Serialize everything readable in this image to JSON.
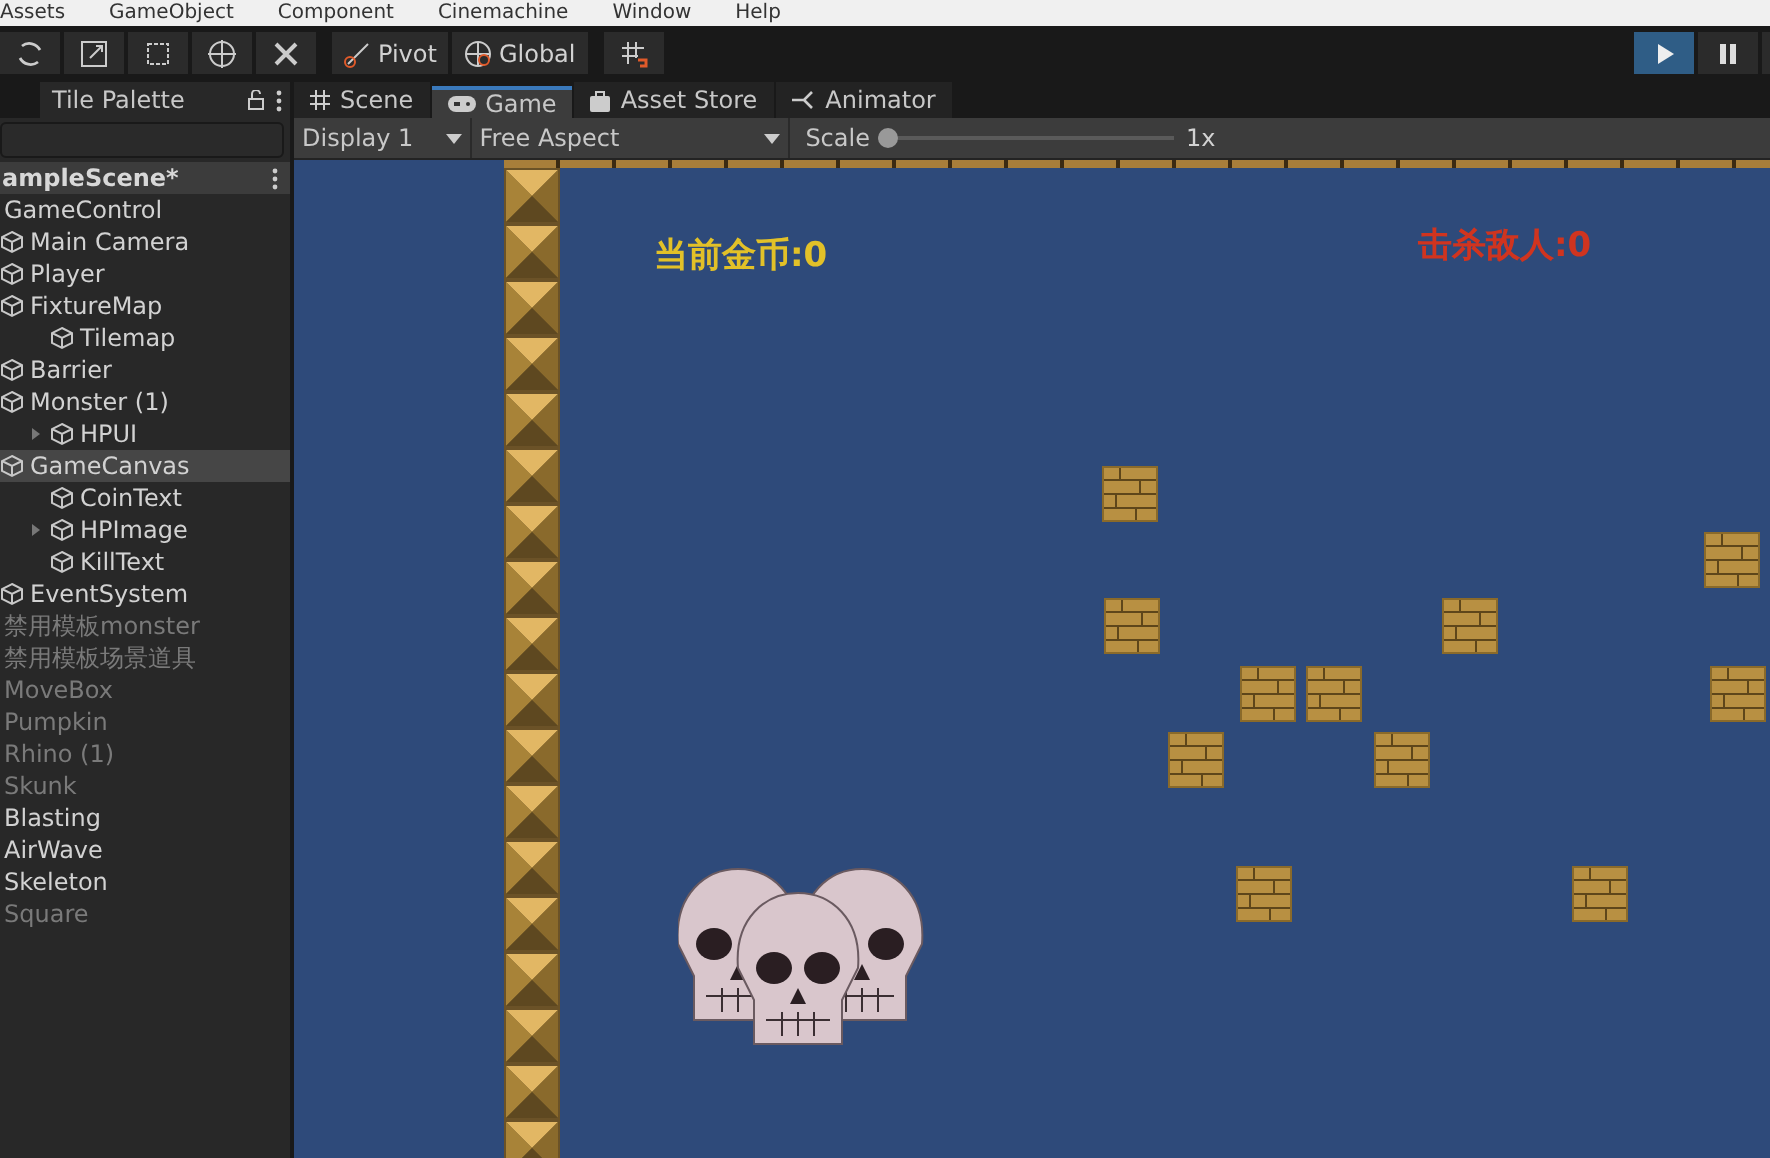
{
  "menu": [
    "Assets",
    "GameObject",
    "Component",
    "Cinemachine",
    "Window",
    "Help"
  ],
  "toolbar": {
    "pivot": "Pivot",
    "global": "Global",
    "play": {
      "selected": true
    },
    "pause": {
      "selected": false
    }
  },
  "left_tabs": [
    {
      "label": "Tile Palette"
    }
  ],
  "hierarchy": {
    "scene": "ampleScene*",
    "items": [
      {
        "name": "GameControl",
        "icon": false,
        "disabled": false,
        "selected": false,
        "collapsed": false
      },
      {
        "name": "Main Camera",
        "icon": true,
        "disabled": false,
        "selected": false,
        "collapsed": false
      },
      {
        "name": "Player",
        "icon": true,
        "disabled": false,
        "selected": false,
        "collapsed": false
      },
      {
        "name": "FixtureMap",
        "icon": true,
        "disabled": false,
        "selected": false,
        "collapsed": false,
        "children": [
          {
            "name": "Tilemap",
            "icon": true,
            "disabled": false,
            "selected": false,
            "collapsed": false
          }
        ]
      },
      {
        "name": "Barrier",
        "icon": true,
        "disabled": false,
        "selected": false,
        "collapsed": false
      },
      {
        "name": "Monster (1)",
        "icon": true,
        "disabled": false,
        "selected": false,
        "collapsed": false,
        "children": [
          {
            "name": "HPUI",
            "icon": true,
            "disabled": false,
            "selected": false,
            "collapsed": true
          }
        ]
      },
      {
        "name": "GameCanvas",
        "icon": true,
        "disabled": false,
        "selected": true,
        "collapsed": false,
        "children": [
          {
            "name": "CoinText",
            "icon": true,
            "disabled": false,
            "selected": false,
            "collapsed": false
          },
          {
            "name": "HPImage",
            "icon": true,
            "disabled": false,
            "selected": false,
            "collapsed": true
          },
          {
            "name": "KillText",
            "icon": true,
            "disabled": false,
            "selected": false,
            "collapsed": false
          }
        ]
      },
      {
        "name": "EventSystem",
        "icon": true,
        "disabled": false,
        "selected": false,
        "collapsed": false
      },
      {
        "name": "禁用模板monster",
        "icon": false,
        "disabled": true,
        "selected": false,
        "collapsed": false
      },
      {
        "name": "禁用模板场景道具",
        "icon": false,
        "disabled": true,
        "selected": false,
        "collapsed": false
      },
      {
        "name": "MoveBox",
        "icon": false,
        "disabled": true,
        "selected": false,
        "collapsed": false
      },
      {
        "name": "Pumpkin",
        "icon": false,
        "disabled": true,
        "selected": false,
        "collapsed": false
      },
      {
        "name": "Rhino (1)",
        "icon": false,
        "disabled": true,
        "selected": false,
        "collapsed": false
      },
      {
        "name": "Skunk",
        "icon": false,
        "disabled": true,
        "selected": false,
        "collapsed": false
      },
      {
        "name": "Blasting",
        "icon": false,
        "disabled": false,
        "selected": false,
        "collapsed": false
      },
      {
        "name": "AirWave",
        "icon": false,
        "disabled": false,
        "selected": false,
        "collapsed": false
      },
      {
        "name": "Skeleton",
        "icon": false,
        "disabled": false,
        "selected": false,
        "collapsed": false
      },
      {
        "name": "Square",
        "icon": false,
        "disabled": true,
        "selected": false,
        "collapsed": false
      }
    ]
  },
  "view_tabs": [
    {
      "label": "Scene",
      "kind": "scene",
      "selected": false
    },
    {
      "label": "Game",
      "kind": "game",
      "selected": true
    },
    {
      "label": "Asset Store",
      "kind": "store",
      "selected": false
    },
    {
      "label": "Animator",
      "kind": "animator",
      "selected": false
    }
  ],
  "game_toolbar": {
    "display": "Display 1",
    "aspect": "Free Aspect",
    "scale_label": "Scale",
    "scale": {
      "level": 0.0
    },
    "scale_reading": "1x"
  },
  "game": {
    "coin_text": "当前金币:0",
    "kill_text": "击杀敌人:0"
  }
}
